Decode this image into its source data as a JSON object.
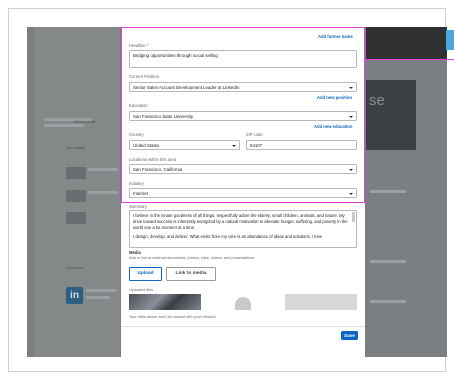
{
  "modal": {
    "headline_label": "Headline *",
    "headline_value": "Bridging opportunities through social selling",
    "add_former_name": "Add former name",
    "current_position_label": "Current Position",
    "current_position_value": "Senior Sales Account Development Leader at LinkedIn",
    "add_new_position": "Add new position",
    "education_label": "Education",
    "education_value": "San Francisco State University",
    "add_new_education": "Add new education",
    "country_label": "Country",
    "country_value": "United States",
    "zip_label": "ZIP code",
    "zip_value": "94107",
    "locations_label": "Locations within this area",
    "locations_value": "San Francisco, California",
    "industry_label": "Industry",
    "industry_value": "Internet",
    "summary_label": "Summary",
    "summary_p1": "I believe in the innate goodness of all things, respectfully adore the elderly, small children, animals, and nature. My drive toward success is inherently energized by a natural motivation to alleviate hunger, suffering, and poverty in the world one a ha moment at a time.",
    "summary_p2": "I design, develop, and deliver. What emits from my core is an abundance of ideas and solutions. I love",
    "media_label": "Media",
    "media_hint": "Add or link to external documents, photos, sites, videos, and presentations.",
    "upload_button": "Upload",
    "link_button": "Link to media",
    "uploaded_files_label": "Uploaded files",
    "footer_note": "Your edits above won't be shared with your network.",
    "save_button": "Save"
  },
  "background": {
    "li_logo": "in",
    "right_heading": "se",
    "left_items": [
      "All their profile",
      "Your Activity",
      "Experience"
    ]
  },
  "colors": {
    "accent": "#0a66c2",
    "highlight": "#e040e0",
    "overlay": "#7c7f82"
  }
}
